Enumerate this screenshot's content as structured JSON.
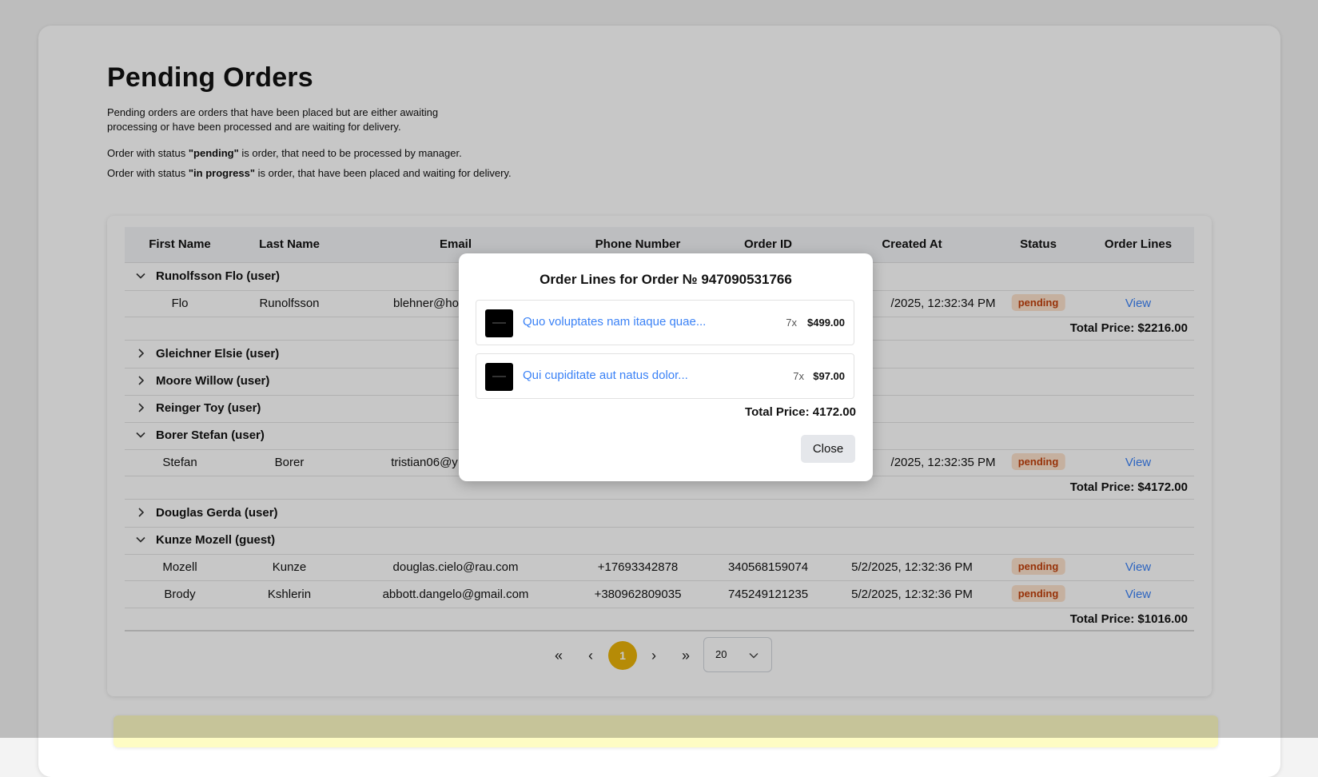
{
  "page": {
    "title": "Pending Orders",
    "description": "Pending orders are orders that have been placed but are either awaiting processing or have been processed and are waiting for delivery.",
    "note_pending": {
      "prefix": "Order with status ",
      "status": "\"pending\"",
      "suffix": " is order, that need to be processed by manager."
    },
    "note_in_progress": {
      "prefix": "Order with status ",
      "status": "\"in progress\"",
      "suffix": " is order, that have been placed and waiting for delivery."
    }
  },
  "table": {
    "columns": [
      "First Name",
      "Last Name",
      "Email",
      "Phone Number",
      "Order ID",
      "Created At",
      "Status",
      "Order Lines"
    ],
    "groups": [
      {
        "label": "Runolfsson Flo (user)",
        "expanded": true,
        "rows": [
          {
            "first": "Flo",
            "last": "Runolfsson",
            "email": "blehner@ho",
            "phone": "",
            "order_id": "",
            "created": "/2025, 12:32:34 PM",
            "status": "pending",
            "lines": "View"
          }
        ],
        "total": "Total Price: $2216.00"
      },
      {
        "label": "Gleichner Elsie (user)",
        "expanded": false
      },
      {
        "label": "Moore Willow (user)",
        "expanded": false
      },
      {
        "label": "Reinger Toy (user)",
        "expanded": false
      },
      {
        "label": "Borer Stefan (user)",
        "expanded": true,
        "rows": [
          {
            "first": "Stefan",
            "last": "Borer",
            "email": "tristian06@y",
            "phone": "",
            "order_id": "",
            "created": "/2025, 12:32:35 PM",
            "status": "pending",
            "lines": "View"
          }
        ],
        "total": "Total Price: $4172.00"
      },
      {
        "label": "Douglas Gerda (user)",
        "expanded": false
      },
      {
        "label": "Kunze Mozell (guest)",
        "expanded": true,
        "rows": [
          {
            "first": "Mozell",
            "last": "Kunze",
            "email": "douglas.cielo@rau.com",
            "phone": "+17693342878",
            "order_id": "340568159074",
            "created": "5/2/2025, 12:32:36 PM",
            "status": "pending",
            "lines": "View"
          },
          {
            "first": "Brody",
            "last": "Kshlerin",
            "email": "abbott.dangelo@gmail.com",
            "phone": "+380962809035",
            "order_id": "745249121235",
            "created": "5/2/2025, 12:32:36 PM",
            "status": "pending",
            "lines": "View"
          }
        ],
        "total": "Total Price: $1016.00"
      }
    ]
  },
  "pagination": {
    "first": "«",
    "prev": "‹",
    "current": "1",
    "next": "›",
    "last": "»",
    "page_size": "20"
  },
  "modal": {
    "title": "Order Lines for Order № 947090531766",
    "lines": [
      {
        "name": "Quo voluptates nam itaque quae...",
        "qty": "7x",
        "price": "$499.00"
      },
      {
        "name": "Qui cupiditate aut natus dolor...",
        "qty": "7x",
        "price": "$97.00"
      }
    ],
    "total": "Total Price: 4172.00",
    "close_label": "Close"
  },
  "colors": {
    "accent": "#eab308",
    "link": "#3b82f6",
    "badge_bg": "#fde2cc",
    "badge_text": "#c2410c"
  }
}
